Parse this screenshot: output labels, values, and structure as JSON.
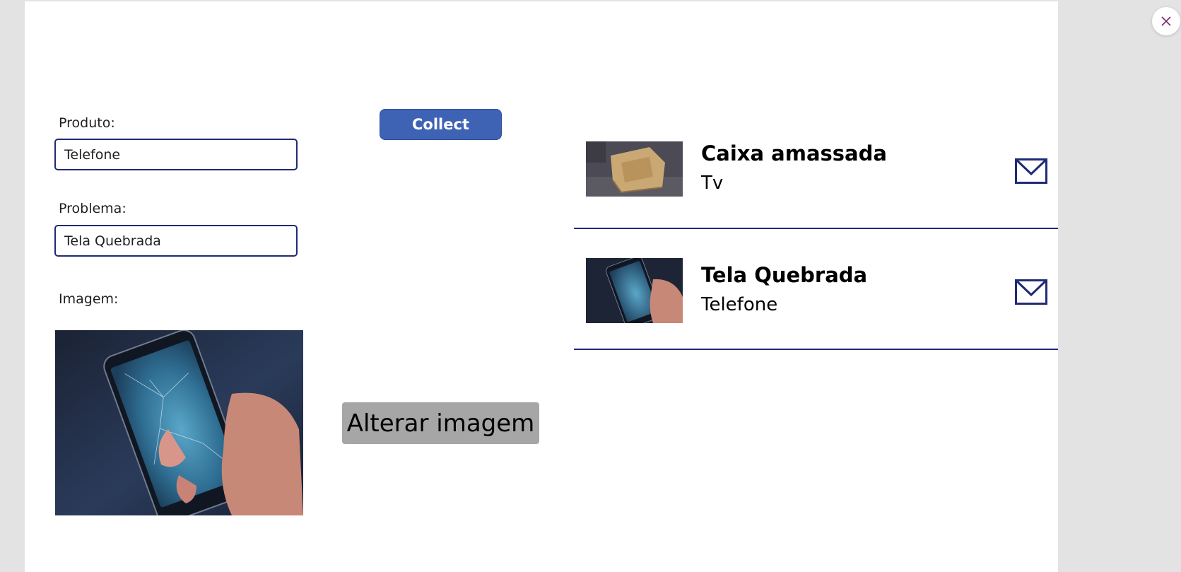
{
  "form": {
    "produto_label": "Produto:",
    "produto_value": "Telefone",
    "problema_label": "Problema:",
    "problema_value": "Tela Quebrada",
    "imagem_label": "Imagem:",
    "collect_label": "Collect",
    "change_image_label": "Alterar imagem"
  },
  "gallery": {
    "items": [
      {
        "title": "Caixa amassada",
        "subtitle": "Tv",
        "icon": "mail-icon"
      },
      {
        "title": "Tela Quebrada",
        "subtitle": "Telefone",
        "icon": "mail-icon"
      }
    ]
  },
  "icons": {
    "close": "close-icon",
    "mail": "mail-icon"
  },
  "colors": {
    "accent": "#3f63b4",
    "border": "#1f2a77",
    "close_glyph": "#742774",
    "button_gray": "#a6a6a6"
  }
}
